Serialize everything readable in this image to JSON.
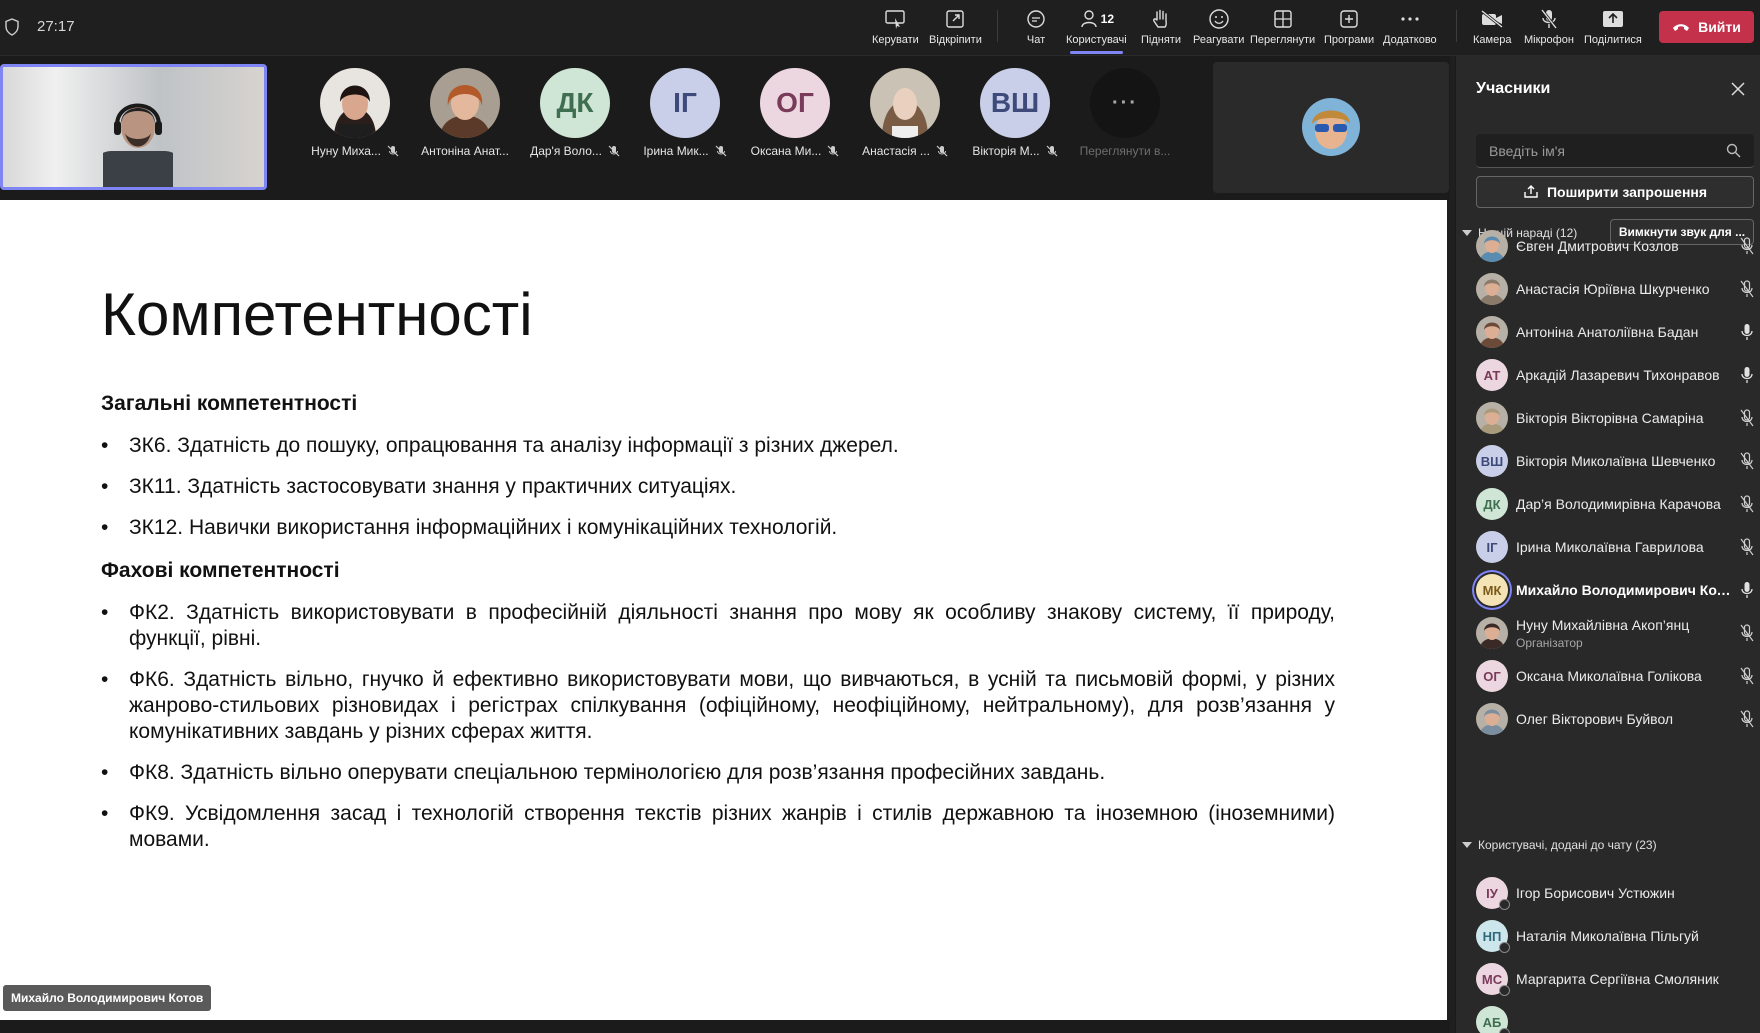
{
  "timer": "27:17",
  "toolbar": {
    "items": [
      {
        "label": "Керувати",
        "icon": "control-icon"
      },
      {
        "label": "Відкріпити",
        "icon": "popout-icon"
      },
      {
        "label": "Чат",
        "icon": "chat-icon"
      },
      {
        "label": "Користувачі",
        "icon": "people-icon",
        "count": "12"
      },
      {
        "label": "Підняти",
        "icon": "raise-hand-icon"
      },
      {
        "label": "Реагувати",
        "icon": "react-icon"
      },
      {
        "label": "Переглянути",
        "icon": "view-icon"
      },
      {
        "label": "Програми",
        "icon": "apps-icon"
      },
      {
        "label": "Додатково",
        "icon": "more-icon"
      },
      {
        "label": "Камера",
        "icon": "camera-off-icon"
      },
      {
        "label": "Мікрофон",
        "icon": "mic-off-icon"
      },
      {
        "label": "Поділитися",
        "icon": "share-icon"
      }
    ],
    "leave_label": "Вийти"
  },
  "gallery": {
    "tiles": [
      {
        "name": "Нуну Миха...",
        "initials": "",
        "bg": "#3a2a25"
      },
      {
        "name": "Антоніна Анат...",
        "initials": "",
        "bg": "#6b4a3a"
      },
      {
        "name": "Дар'я Воло...",
        "initials": "ДК",
        "bg": "#cfe6d6",
        "fg": "#3f6f50"
      },
      {
        "name": "Ірина Мик...",
        "initials": "ІГ",
        "bg": "#c9cfe8",
        "fg": "#3d4a7a"
      },
      {
        "name": "Оксана Ми...",
        "initials": "ОГ",
        "bg": "#ecd7e0",
        "fg": "#7a3a5a"
      },
      {
        "name": "Анастасія ...",
        "initials": "",
        "bg": "#8a7a6a"
      },
      {
        "name": "Вікторія М...",
        "initials": "ВШ",
        "bg": "#c9cfe8",
        "fg": "#3d4a7a"
      },
      {
        "name": "Переглянути в...",
        "initials": "···",
        "bg": "#141414",
        "more": true
      }
    ]
  },
  "slide": {
    "title": "Компетентності",
    "general_heading": "Загальні компетентності",
    "general": [
      "ЗК6. Здатність до пошуку, опрацювання та аналізу інформації з різних джерел.",
      "ЗК11. Здатність застосовувати знання у практичних ситуаціях.",
      "ЗК12. Навички використання інформаційних і комунікаційних технологій."
    ],
    "prof_heading": "Фахові компетентності",
    "prof": [
      "ФК2. Здатність використовувати в професійній діяльності знання про мову як особливу знакову систему, її природу, функції, рівні.",
      "ФК6. Здатність вільно, гнучко й ефективно використовувати мови, що вивчаються, в усній та письмовій формі, у різних жанрово-стильових різновидах і регістрах спілкування (офіційному, неофіційному, нейтральному), для розв’язання у комунікативних завдань у різних сферах життя.",
      "ФК8. Здатність вільно оперувати спеціальною термінологією для розв’язання професійних завдань.",
      "ФК9. Усвідомлення засад і технологій створення текстів різних жанрів і стилів державною та іноземною (іноземними) мовами."
    ],
    "presenter": "Михайло Володимирович Котов"
  },
  "panel": {
    "title": "Учасники",
    "search_placeholder": "Введіть ім'я",
    "invite_label": "Поширити запрошення",
    "in_meeting_label": "На цій нараді (12)",
    "mute_all_label": "Вимкнути звук для ...",
    "participants": [
      {
        "name": "Євген Дмитрович Козлов",
        "initials": "",
        "bg": "#5a8bb0",
        "mic": "off"
      },
      {
        "name": "Анастасія Юріївна Шкурченко",
        "initials": "",
        "bg": "#8a7a6a",
        "mic": "off"
      },
      {
        "name": "Антоніна Анатоліївна Бадан",
        "initials": "",
        "bg": "#6b4a3a",
        "mic": "on"
      },
      {
        "name": "Аркадій Лазаревич Тихонравов",
        "initials": "АТ",
        "bg": "#ecd7e0",
        "fg": "#7a3a5a",
        "mic": "on"
      },
      {
        "name": "Вікторія Вікторівна Самаріна",
        "initials": "",
        "bg": "#a89a7a",
        "mic": "off"
      },
      {
        "name": "Вікторія Миколаївна Шевченко",
        "initials": "ВШ",
        "bg": "#c9cfe8",
        "fg": "#3d4a7a",
        "mic": "off"
      },
      {
        "name": "Дар’я Володимирівна Карачова",
        "initials": "ДК",
        "bg": "#cfe6d6",
        "fg": "#3f6f50",
        "mic": "off"
      },
      {
        "name": "Ірина Миколаївна Гаврилова",
        "initials": "ІГ",
        "bg": "#c9cfe8",
        "fg": "#3d4a7a",
        "mic": "off"
      },
      {
        "name": "Михайло Володимирович Кот...",
        "initials": "МК",
        "bg": "#f4e3b5",
        "fg": "#7a5a1a",
        "mic": "on",
        "me": true
      },
      {
        "name": "Нуну Михайлівна Акоп’янц",
        "role": "Організатор",
        "initials": "",
        "bg": "#3a2a25",
        "mic": "off"
      },
      {
        "name": "Оксана Миколаївна Голікова",
        "initials": "ОГ",
        "bg": "#ecd7e0",
        "fg": "#7a3a5a",
        "mic": "off"
      },
      {
        "name": "Олег Вікторович Буйвол",
        "initials": "",
        "bg": "#7a8ea0",
        "mic": "off"
      }
    ],
    "chat_label": "Користувачі, додані до чату (23)",
    "chat_users": [
      {
        "name": "Ігор Борисович Устюжин",
        "initials": "ІУ",
        "bg": "#ecd7e0",
        "fg": "#7a3a5a"
      },
      {
        "name": "Наталія Миколаївна Пільгуй",
        "initials": "НП",
        "bg": "#cde6ec",
        "fg": "#2f6a7a"
      },
      {
        "name": "Маргарита Сергіївна Смоляник",
        "initials": "МС",
        "bg": "#ecd7e0",
        "fg": "#7a3a5a"
      },
      {
        "name": "",
        "initials": "АБ",
        "bg": "#cfe6d6",
        "fg": "#3f6f50"
      }
    ]
  }
}
